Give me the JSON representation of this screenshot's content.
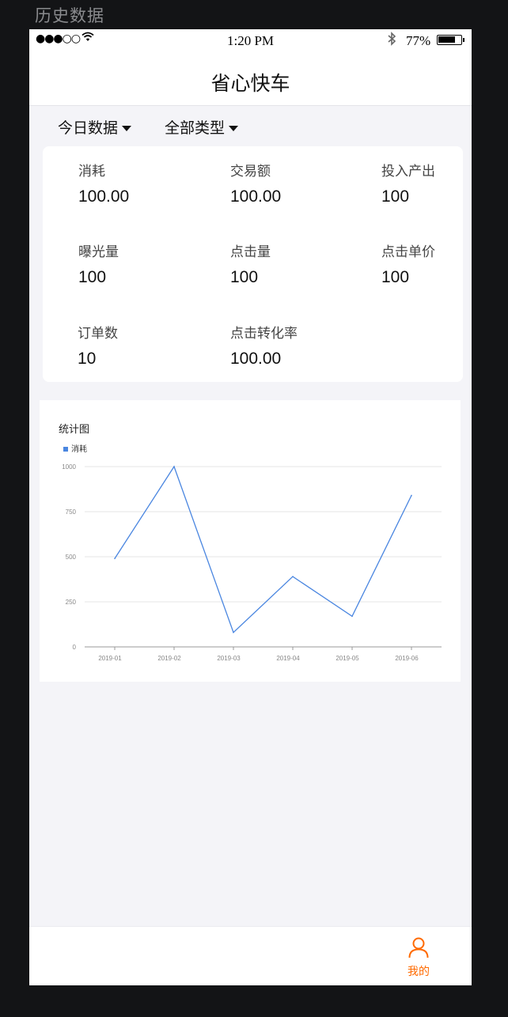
{
  "artboard_title": "历史数据",
  "status_bar": {
    "signal": "●●●○○",
    "time": "1:20 PM",
    "battery_percent": "77%",
    "battery_level": 0.77
  },
  "nav": {
    "title": "省心快车"
  },
  "filters": [
    {
      "label": "今日数据"
    },
    {
      "label": "全部类型"
    }
  ],
  "metrics": [
    {
      "label": "消耗",
      "value": "100.00"
    },
    {
      "label": "交易额",
      "value": "100.00"
    },
    {
      "label": "投入产出",
      "value": "100"
    },
    {
      "label": "曝光量",
      "value": "100"
    },
    {
      "label": "点击量",
      "value": "100"
    },
    {
      "label": "点击单价",
      "value": "100"
    },
    {
      "label": "订单数",
      "value": "10"
    },
    {
      "label": "点击转化率",
      "value": "100.00"
    }
  ],
  "chart_data": {
    "type": "line",
    "title": "统计图",
    "x": [
      "2019-01",
      "2019-02",
      "2019-03",
      "2019-04",
      "2019-05",
      "2019-06"
    ],
    "series": [
      {
        "name": "消耗",
        "values": [
          490,
          1000,
          80,
          390,
          170,
          840
        ],
        "color": "#4a86e0"
      }
    ],
    "ylim": [
      0,
      1000
    ],
    "yticks": [
      "0",
      "250",
      "500",
      "750",
      "1000"
    ],
    "grid": true,
    "legend": "top-left"
  },
  "tabbar": {
    "me_label": "我的",
    "accent": "#ff6a00"
  }
}
